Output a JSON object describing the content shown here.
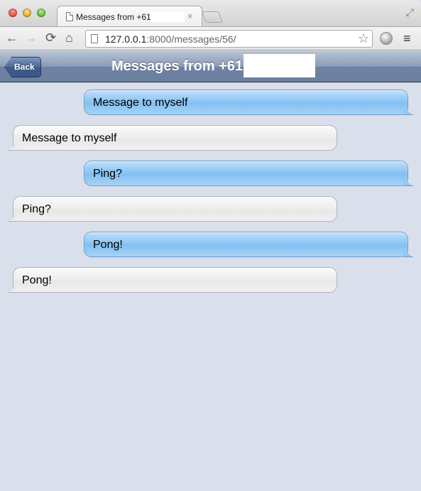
{
  "browser": {
    "tab_title": "Messages from +61",
    "tab_close": "×",
    "url_host": "127.0.0.1",
    "url_rest": ":8000/messages/56/",
    "icons": {
      "back": "back-arrow-icon",
      "forward": "forward-arrow-icon",
      "reload": "reload-icon",
      "home": "home-icon",
      "page": "page-icon",
      "star": "star-icon",
      "extension": "extension-icon",
      "menu": "menu-icon",
      "fullscreen": "fullscreen-icon"
    }
  },
  "header": {
    "back_label": "Back",
    "title": "Messages from +61"
  },
  "messages": [
    {
      "direction": "sent",
      "text": "Message to myself"
    },
    {
      "direction": "received",
      "text": "Message to myself"
    },
    {
      "direction": "sent",
      "text": "Ping?"
    },
    {
      "direction": "received",
      "text": "Ping?"
    },
    {
      "direction": "sent",
      "text": "Pong!"
    },
    {
      "direction": "received",
      "text": "Pong!"
    }
  ],
  "colors": {
    "background": "#d9dfeb",
    "sent_bubble": "#8cc5f4",
    "received_bubble": "#eeeeee",
    "header_bar": "#6e82a3"
  }
}
